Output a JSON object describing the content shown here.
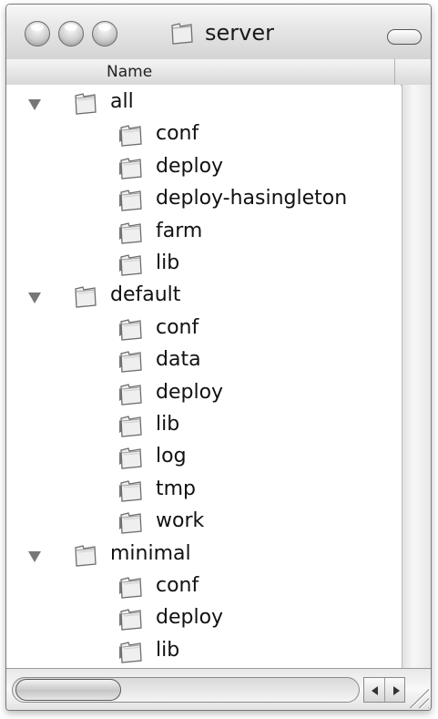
{
  "window": {
    "title": "server"
  },
  "column": {
    "name_label": "Name"
  },
  "tree": [
    {
      "label": "all",
      "level": 0,
      "expanded": true
    },
    {
      "label": "conf",
      "level": 1,
      "expanded": false
    },
    {
      "label": "deploy",
      "level": 1,
      "expanded": false
    },
    {
      "label": "deploy-hasingleton",
      "level": 1,
      "expanded": false
    },
    {
      "label": "farm",
      "level": 1,
      "expanded": false
    },
    {
      "label": "lib",
      "level": 1,
      "expanded": false
    },
    {
      "label": "default",
      "level": 0,
      "expanded": true
    },
    {
      "label": "conf",
      "level": 1,
      "expanded": false
    },
    {
      "label": "data",
      "level": 1,
      "expanded": false
    },
    {
      "label": "deploy",
      "level": 1,
      "expanded": false
    },
    {
      "label": "lib",
      "level": 1,
      "expanded": false
    },
    {
      "label": "log",
      "level": 1,
      "expanded": false
    },
    {
      "label": "tmp",
      "level": 1,
      "expanded": false
    },
    {
      "label": "work",
      "level": 1,
      "expanded": false
    },
    {
      "label": "minimal",
      "level": 0,
      "expanded": true
    },
    {
      "label": "conf",
      "level": 1,
      "expanded": false
    },
    {
      "label": "deploy",
      "level": 1,
      "expanded": false
    },
    {
      "label": "lib",
      "level": 1,
      "expanded": false
    }
  ]
}
